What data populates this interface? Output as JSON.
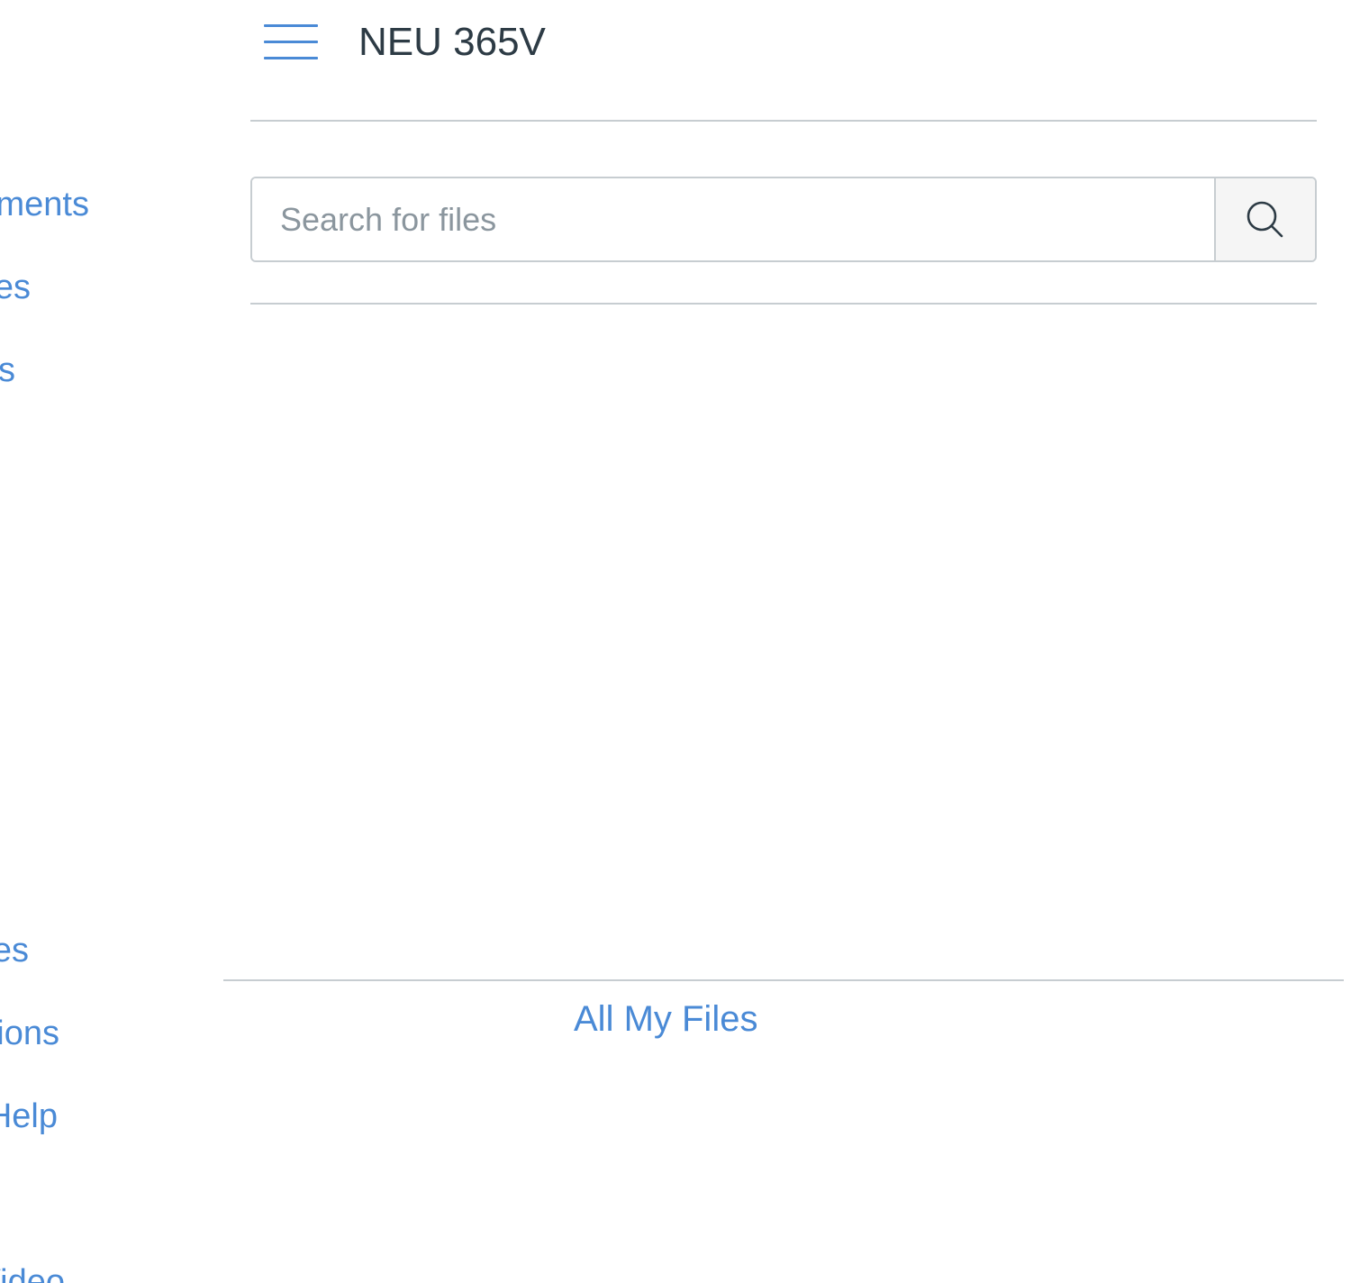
{
  "header": {
    "course_title": "NEU 365V",
    "menu_icon": "hamburger-menu-icon"
  },
  "course_nav": {
    "items": [
      {
        "label": "Assignments"
      },
      {
        "label": "Grades"
      },
      {
        "label": "Modules"
      },
      {
        "label": "Files"
      },
      {
        "label": "Discussions"
      },
      {
        "label": "Help"
      },
      {
        "label": "Video"
      }
    ]
  },
  "search": {
    "placeholder": "Search for files",
    "value": "",
    "button_icon": "search-icon"
  },
  "footer": {
    "all_files_link": "All My Files"
  },
  "colors": {
    "link": "#4a8ad6",
    "text": "#2d3b45",
    "border": "#c7cdd1"
  }
}
